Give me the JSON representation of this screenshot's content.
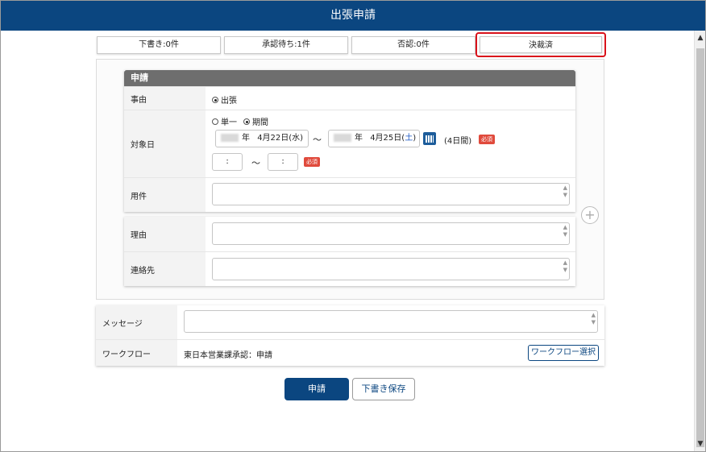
{
  "title": "出張申請",
  "tabs": [
    {
      "label": "下書き:0件"
    },
    {
      "label": "承認待ち:1件"
    },
    {
      "label": "否認:0件"
    },
    {
      "label": "決裁済"
    }
  ],
  "form": {
    "header": "申請",
    "reason_label": "事由",
    "reason_option": "出張",
    "date_label": "対象日",
    "date_mode_single": "単一",
    "date_mode_period": "期間",
    "date_start_year_suffix": "年",
    "date_start": "4月22日(水)",
    "date_sep": "～",
    "date_end_year_suffix": "年",
    "date_end_prefix": "4月25日(",
    "date_end_weekday": "土",
    "date_end_suffix": ")",
    "days_count": "(4日間)",
    "required_badge": "必須",
    "time_start": ":",
    "time_sep": "～",
    "time_end": ":",
    "subject_label": "用件",
    "purpose_label": "理由",
    "contact_label": "連絡先"
  },
  "message": {
    "label": "メッセージ",
    "workflow_label": "ワークフロー",
    "workflow_value": "東日本営業課承認：申請",
    "workflow_button": "ワークフロー選択"
  },
  "buttons": {
    "submit": "申請",
    "save_draft": "下書き保存"
  },
  "scrollbar": {
    "up": "▲",
    "down": "▼"
  },
  "colors": {
    "primary": "#0b4680",
    "required": "#e04a3c",
    "highlight_border": "#d9121b",
    "saturday": "#1a56c4"
  }
}
